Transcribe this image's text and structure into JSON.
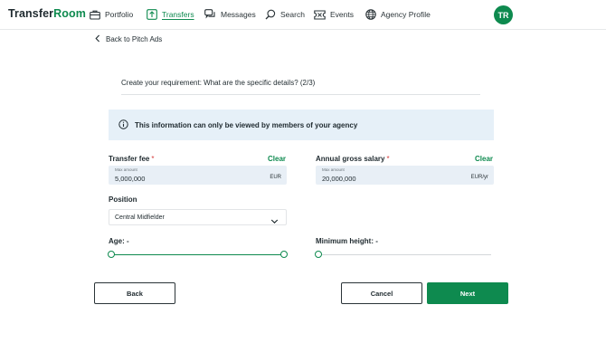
{
  "brand": {
    "part1": "Transfer",
    "part2": "Room"
  },
  "nav": {
    "items": [
      {
        "label": "Portfolio",
        "icon": "briefcase-icon",
        "active": false
      },
      {
        "label": "Transfers",
        "icon": "transfer-icon",
        "active": true
      },
      {
        "label": "Messages",
        "icon": "chat-bubbles-icon",
        "active": false
      },
      {
        "label": "Search",
        "icon": "search-icon",
        "active": false
      },
      {
        "label": "Events",
        "icon": "ticket-icon",
        "active": false
      },
      {
        "label": "Agency Profile",
        "icon": "globe-icon",
        "active": false
      }
    ],
    "avatar_initials": "TR"
  },
  "back_link": "Back to Pitch Ads",
  "step_title": "Create your requirement: What are the specific details? (2/3)",
  "info_text": "This information can only be viewed by members of your agency",
  "transfer_fee": {
    "label": "Transfer fee",
    "required_mark": "*",
    "clear_label": "Clear",
    "caption": "Max amount",
    "value": "5,000,000",
    "unit": "EUR"
  },
  "salary": {
    "label": "Annual gross salary",
    "required_mark": "*",
    "clear_label": "Clear",
    "caption": "Max amount",
    "value": "20,000,000",
    "unit": "EUR/yr"
  },
  "position": {
    "label": "Position",
    "selected": "Central Midfielder"
  },
  "age": {
    "label": "Age: -",
    "range_fill": [
      0,
      1
    ]
  },
  "min_height": {
    "label": "Minimum height: -",
    "level": 0
  },
  "buttons": {
    "back": "Back",
    "cancel": "Cancel",
    "next": "Next"
  },
  "colors": {
    "accent": "#0e8a4f",
    "info_bg": "#e6f0f8",
    "input_bg": "#e8eff6"
  }
}
